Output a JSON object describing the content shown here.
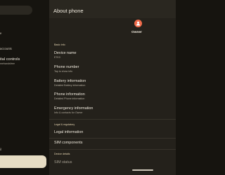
{
  "left_pane": {
    "items": [
      {
        "title": "",
        "subtitle": "e"
      },
      {
        "title": "",
        "subtitle": "accounts"
      },
      {
        "title": "ital controls",
        "subtitle": "mehandsfree"
      }
    ],
    "bottom_text": "il"
  },
  "right_pane": {
    "title": "About phone",
    "owner_label": "Owner",
    "sections": {
      "basic_info": "Basic info",
      "legal": "Legal & regulatory",
      "device_details": "Device details"
    },
    "items": {
      "device_name": {
        "title": "Device name",
        "subtitle": "E7K0"
      },
      "phone_number": {
        "title": "Phone number",
        "subtitle": "Tap to show info"
      },
      "battery": {
        "title": "Battery information",
        "subtitle": "Detailed Battery information"
      },
      "phone_info": {
        "title": "Phone information",
        "subtitle": "Detailed Phone information"
      },
      "emergency": {
        "title": "Emergency information",
        "subtitle": "Info & contacts for Owner"
      },
      "legal_info": {
        "title": "Legal information"
      },
      "sim": {
        "title": "SIM components"
      },
      "sim_status": {
        "title": "SIM status"
      }
    }
  },
  "colors": {
    "accent_avatar": "#f06b4b",
    "section_header": "#e7d7b3",
    "selected_pill": "#e6dcc3",
    "right_background": "#24211b",
    "left_background": "#16140f"
  }
}
